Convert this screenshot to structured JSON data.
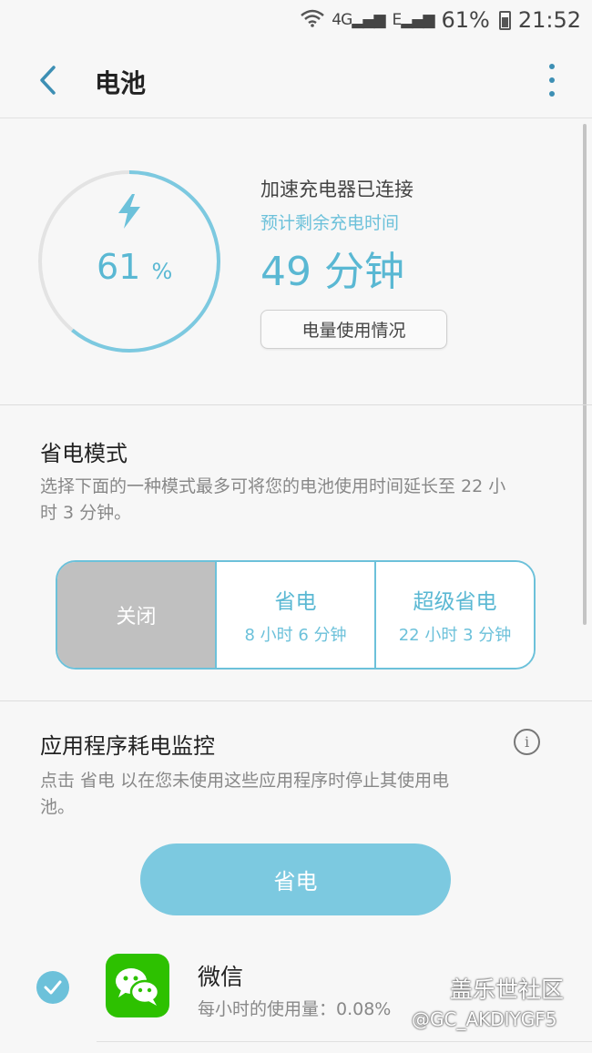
{
  "status_bar": {
    "network": "4G",
    "signal_2": "E",
    "battery": "61%",
    "time": "21:52"
  },
  "app_bar": {
    "title": "电池",
    "back_icon": "chevron-left-icon",
    "menu_icon": "more-vertical-icon"
  },
  "battery": {
    "percent": "61",
    "percent_unit": "%",
    "ring_fraction": 0.61,
    "charger_status": "加速充电器已连接",
    "remaining_label": "预计剩余充电时间",
    "remaining_time": "49 分钟",
    "usage_button": "电量使用情况"
  },
  "power_saving": {
    "title": "省电模式",
    "description": "选择下面的一种模式最多可将您的电池使用时间延长至 22 小时 3 分钟。",
    "modes": [
      {
        "name": "关闭",
        "time": "",
        "selected": true
      },
      {
        "name": "省电",
        "time": "8 小时 6 分钟",
        "selected": false
      },
      {
        "name": "超级省电",
        "time": "22 小时 3 分钟",
        "selected": false
      }
    ]
  },
  "app_monitor": {
    "title": "应用程序耗电监控",
    "description": "点击 省电 以在您未使用这些应用程序时停止其使用电池。",
    "save_button": "省电",
    "apps": [
      {
        "name": "微信",
        "usage": "每小时的使用量：0.08%",
        "checked": true
      }
    ]
  },
  "watermark": {
    "line1": "盖乐世社区",
    "line2": "@GC_AKDIYGF5"
  },
  "colors": {
    "accent": "#5ab8d3",
    "ring_track": "#e3e3e3",
    "mode_selected": "#c0c0c0",
    "wechat_green": "#2dc100"
  }
}
